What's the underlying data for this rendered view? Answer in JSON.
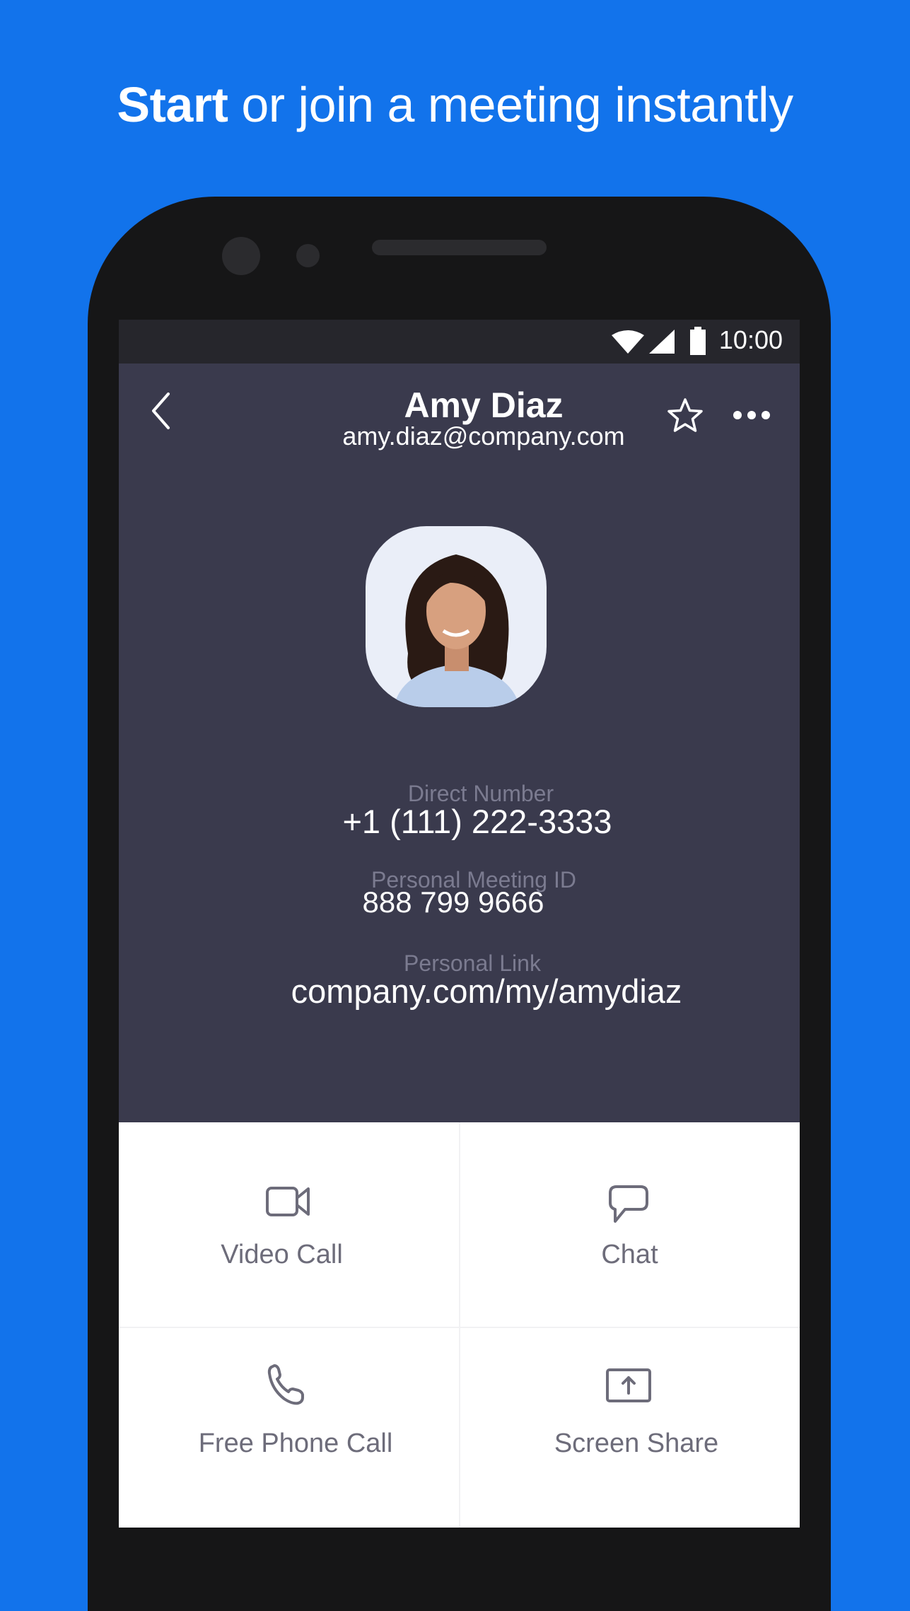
{
  "headline": {
    "bold": "Start",
    "rest": " or join a meeting instantly"
  },
  "status_bar": {
    "time": "10:00",
    "icons": [
      "wifi-icon",
      "signal-icon",
      "battery-icon"
    ]
  },
  "contact": {
    "name": "Amy Diaz",
    "email": "amy.diaz@company.com"
  },
  "header_icons": [
    "back-icon",
    "star-icon",
    "more-icon"
  ],
  "details": [
    {
      "label": "Direct Number",
      "value": "+1 (111) 222-3333"
    },
    {
      "label": "Personal Meeting ID",
      "value": "888 799 9666"
    },
    {
      "label": "Personal Link",
      "value": "company.com/my/amydiaz"
    }
  ],
  "actions": [
    {
      "label": "Video Call",
      "icon": "video-camera-icon"
    },
    {
      "label": "Chat",
      "icon": "chat-bubble-icon"
    },
    {
      "label": "Free Phone Call",
      "icon": "phone-icon"
    },
    {
      "label": "Screen Share",
      "icon": "screen-share-icon"
    }
  ],
  "colors": {
    "background": "#1273eb",
    "header": "#3a3a4d",
    "status_bar": "#26262c",
    "action_text": "#6d6c7a"
  }
}
